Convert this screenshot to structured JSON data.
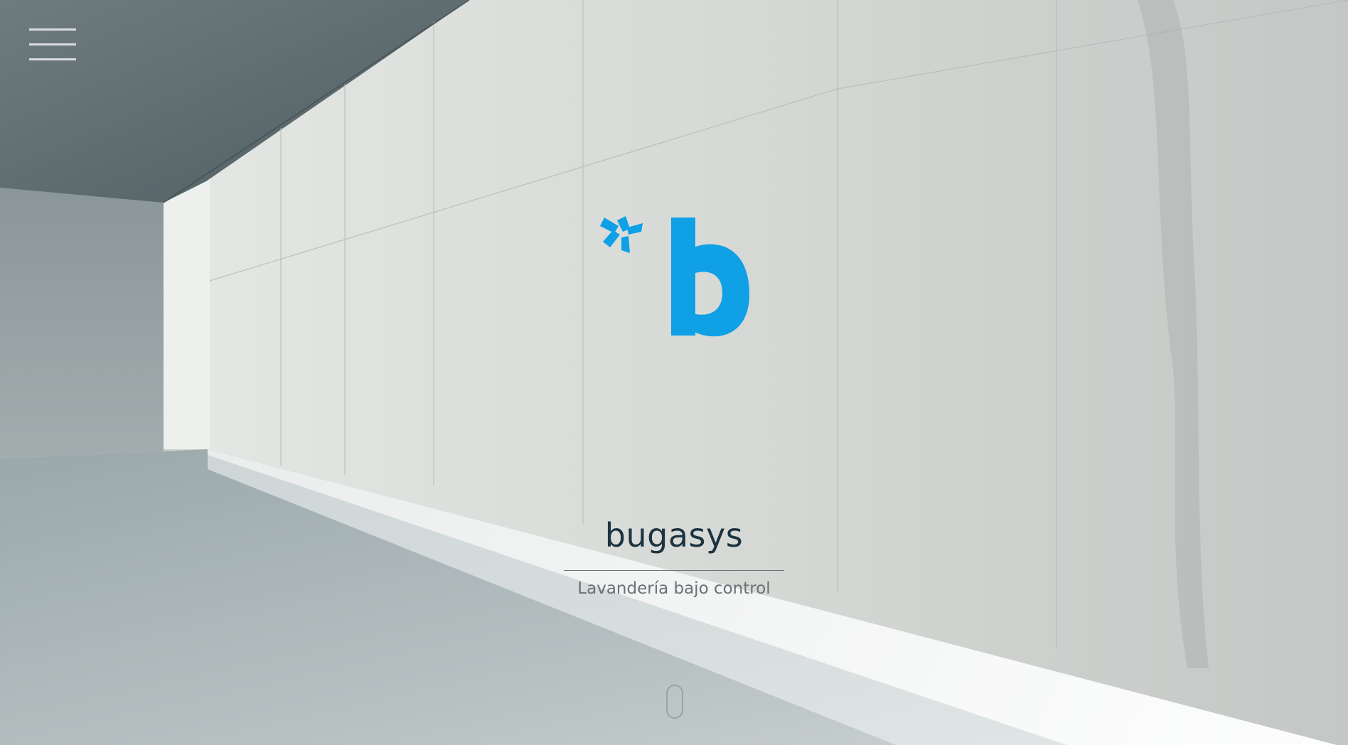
{
  "header": {
    "menu_icon": "hamburger-menu-icon"
  },
  "hero": {
    "logo_icon": "bugasys-b-logo-icon",
    "brand_name": "bugasys",
    "tagline": "Lavandería bajo control",
    "scroll_icon": "scroll-down-mouse-icon"
  },
  "colors": {
    "brand_blue": "#0fa0e6",
    "brand_text": "#1d3340",
    "tagline_text": "#6a7176"
  }
}
